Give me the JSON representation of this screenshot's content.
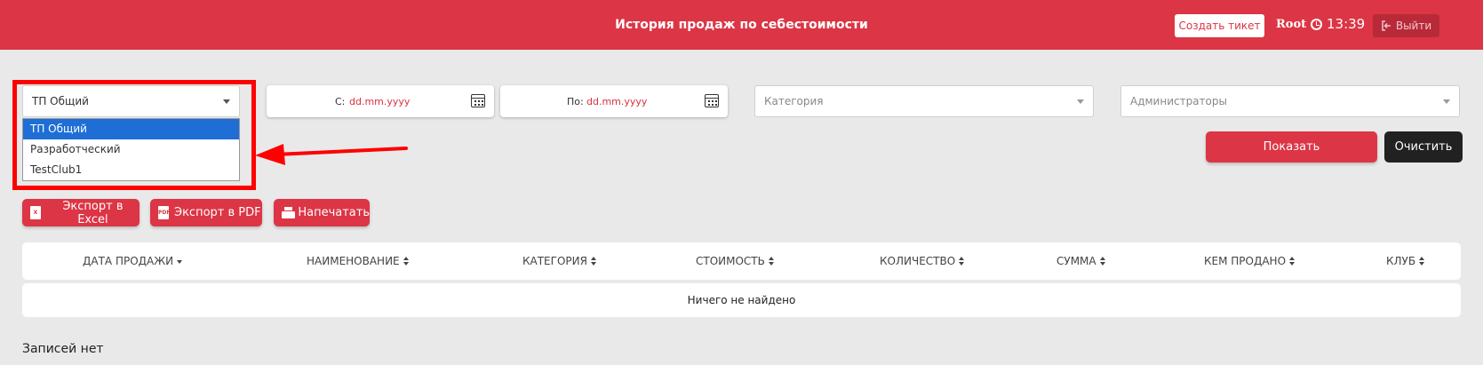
{
  "header": {
    "title": "История продаж по себестоимости",
    "ticket_button": "Создать тикет",
    "user": "Root",
    "time": "13:39",
    "logout_button": "Выйти",
    "brand_color": "#dc3545"
  },
  "filters": {
    "club_select": {
      "value": "ТП Общий",
      "options": [
        "ТП Общий",
        "Разработческий",
        "TestClub1"
      ],
      "selected_index": 0
    },
    "date_from": {
      "label": "С:",
      "value": "dd.mm.yyyy"
    },
    "date_to": {
      "label": "По:",
      "value": "dd.mm.yyyy"
    },
    "category_placeholder": "Категория",
    "admins_placeholder": "Администраторы"
  },
  "actions": {
    "show_button": "Показать",
    "clear_button": "Очистить"
  },
  "export": {
    "excel": "Экспорт в Excel",
    "pdf": "Экспорт в PDF",
    "print": "Напечатать"
  },
  "table": {
    "columns": [
      "ДАТА ПРОДАЖИ",
      "НАИМЕНОВАНИЕ",
      "КАТЕГОРИЯ",
      "СТОИМОСТЬ",
      "КОЛИЧЕСТВО",
      "СУММА",
      "КЕМ ПРОДАНО",
      "КЛУБ"
    ],
    "empty_message": "Ничего не найдено"
  },
  "footer": {
    "records_text": "Записей нет"
  },
  "annotation": {
    "highlight_color": "#ff0000"
  }
}
